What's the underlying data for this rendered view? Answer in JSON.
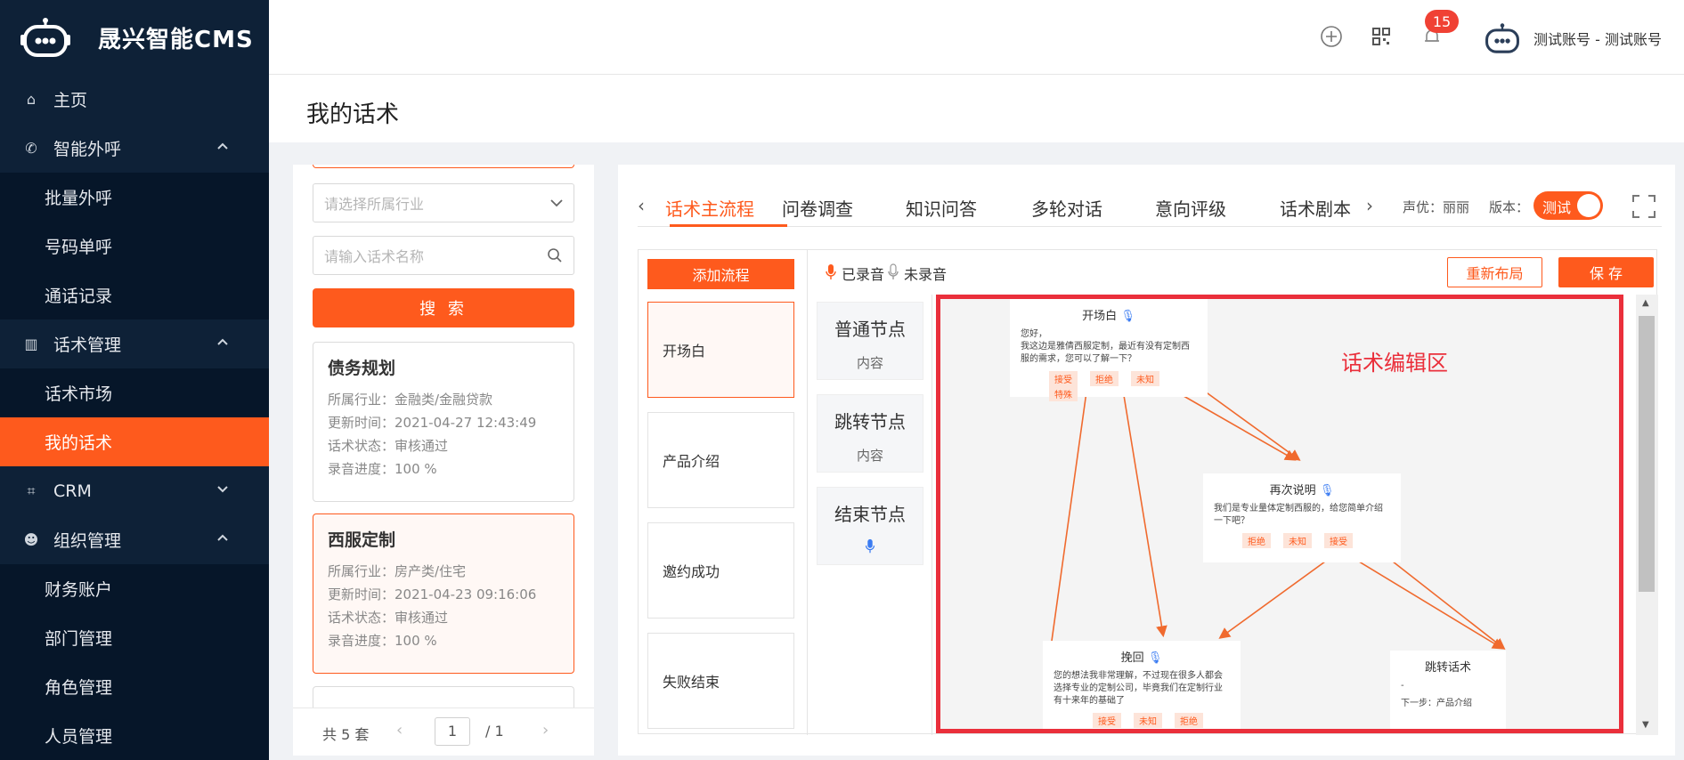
{
  "app": {
    "title": "晟兴智能CMS"
  },
  "sidebar": {
    "items": [
      {
        "label": "主页",
        "type": "top"
      },
      {
        "label": "智能外呼",
        "type": "top",
        "expanded": true
      },
      {
        "label": "批量外呼",
        "type": "sub"
      },
      {
        "label": "号码单呼",
        "type": "sub"
      },
      {
        "label": "通话记录",
        "type": "sub"
      },
      {
        "label": "话术管理",
        "type": "top",
        "expanded": true
      },
      {
        "label": "话术市场",
        "type": "sub"
      },
      {
        "label": "我的话术",
        "type": "sub",
        "active": true
      },
      {
        "label": "CRM",
        "type": "top",
        "expanded": false
      },
      {
        "label": "组织管理",
        "type": "top",
        "expanded": true
      },
      {
        "label": "财务账户",
        "type": "sub"
      },
      {
        "label": "部门管理",
        "type": "sub"
      },
      {
        "label": "角色管理",
        "type": "sub"
      },
      {
        "label": "人员管理",
        "type": "sub"
      }
    ]
  },
  "header": {
    "notification_count": "15",
    "user": "测试账号 - 测试账号"
  },
  "page": {
    "title": "我的话术"
  },
  "left": {
    "industry_placeholder": "请选择所属行业",
    "name_placeholder": "请输入话术名称",
    "search_label": "搜 索",
    "cards": [
      {
        "title": "债务规划",
        "industry": "所属行业：金融类/金融贷款",
        "updated": "更新时间：2021-04-27 12:43:49",
        "status": "话术状态：审核通过",
        "progress": "录音进度：100 %"
      },
      {
        "title": "西服定制",
        "industry": "所属行业：房产类/住宅",
        "updated": "更新时间：2021-04-23 09:16:06",
        "status": "话术状态：审核通过",
        "progress": "录音进度：100 %"
      }
    ],
    "pager": {
      "total": "共 5 套",
      "page": "1",
      "of": "/ 1"
    }
  },
  "main": {
    "tabs": [
      "话术主流程",
      "问卷调查",
      "知识问答",
      "多轮对话",
      "意向评级",
      "话术剧本"
    ],
    "voice": "声优：丽丽",
    "version_label": "版本：",
    "toggle_label": "测试",
    "add_flow": "添加流程",
    "flows": [
      "开场白",
      "产品介绍",
      "邀约成功",
      "失败结束"
    ],
    "legend_recorded": "已录音",
    "legend_unrecorded": "未录音",
    "relayout": "重新布局",
    "save": "保 存",
    "node_types": [
      {
        "title": "普通节点",
        "content": "内容"
      },
      {
        "title": "跳转节点",
        "content": "内容"
      },
      {
        "title": "结束节点",
        "content": ""
      }
    ],
    "canvas": {
      "label": "话术编辑区",
      "nodes": {
        "opening": {
          "title": "开场白",
          "text": "您好，\n我这边是雅倩西服定制，最近有没有定制西服的需求，您可以了解一下？",
          "chips": [
            "接受",
            "拒绝",
            "未知",
            "特殊"
          ]
        },
        "again": {
          "title": "再次说明",
          "text": "我们是专业量体定制西服的，给您简单介绍一下吧？",
          "chips": [
            "拒绝",
            "未知",
            "接受"
          ]
        },
        "retain": {
          "title": "挽回",
          "text": "您的想法我非常理解，不过现在很多人都会选择专业的定制公司，毕竟我们在定制行业有十来年的基础了",
          "chips": [
            "接受",
            "未知",
            "拒绝"
          ]
        },
        "jump": {
          "title": "跳转话术",
          "text": "-",
          "next": "下一步：产品介绍"
        }
      }
    }
  },
  "colors": {
    "accent": "#fe5a1d",
    "sidebar": "#0b1d33",
    "highlight": "#ea2f3b"
  }
}
